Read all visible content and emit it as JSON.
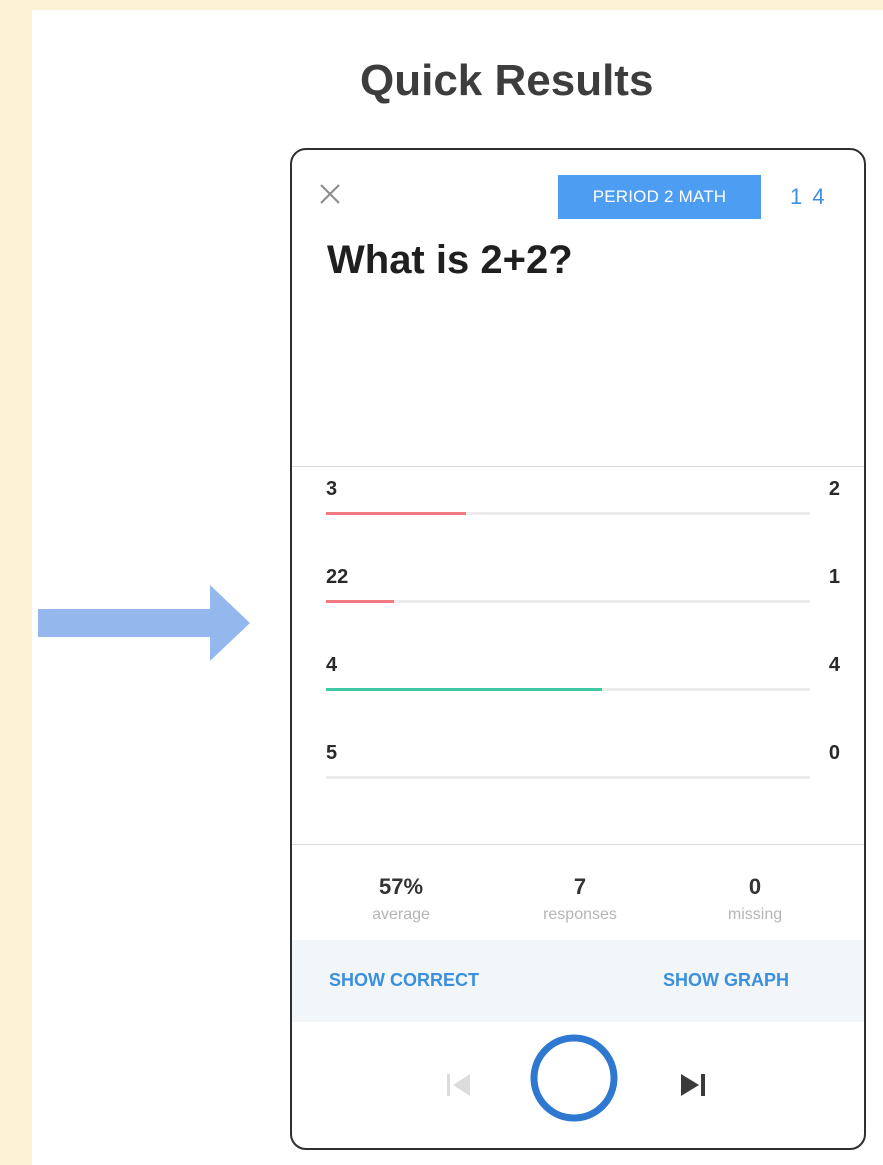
{
  "page": {
    "title": "Quick Results"
  },
  "card": {
    "class_badge": "PERIOD 2 MATH",
    "question_counter": "1 4",
    "question": "What is 2+2?"
  },
  "answers": [
    {
      "label": "3",
      "count": "2",
      "fraction": 0.29,
      "color": "#f07a80"
    },
    {
      "label": "22",
      "count": "1",
      "fraction": 0.14,
      "color": "#f07a80"
    },
    {
      "label": "4",
      "count": "4",
      "fraction": 0.57,
      "color": "#3cc9a4"
    },
    {
      "label": "5",
      "count": "0",
      "fraction": 0,
      "color": "#f07a80"
    }
  ],
  "stats": {
    "average_value": "57%",
    "average_label": "average",
    "responses_value": "7",
    "responses_label": "responses",
    "missing_value": "0",
    "missing_label": "missing"
  },
  "actions": {
    "show_correct": "SHOW CORRECT",
    "show_graph": "SHOW GRAPH"
  },
  "icons": {
    "close": "close-icon",
    "prev": "skip-previous-icon",
    "play": "circle-play-icon",
    "next": "skip-next-icon",
    "arrow": "arrow-right-icon"
  },
  "colors": {
    "accent": "#3a8fdf",
    "badge": "#4d9ef2",
    "wrong": "#f07a80",
    "correct": "#3cc9a4",
    "page_accent": "#fdf2d6"
  }
}
